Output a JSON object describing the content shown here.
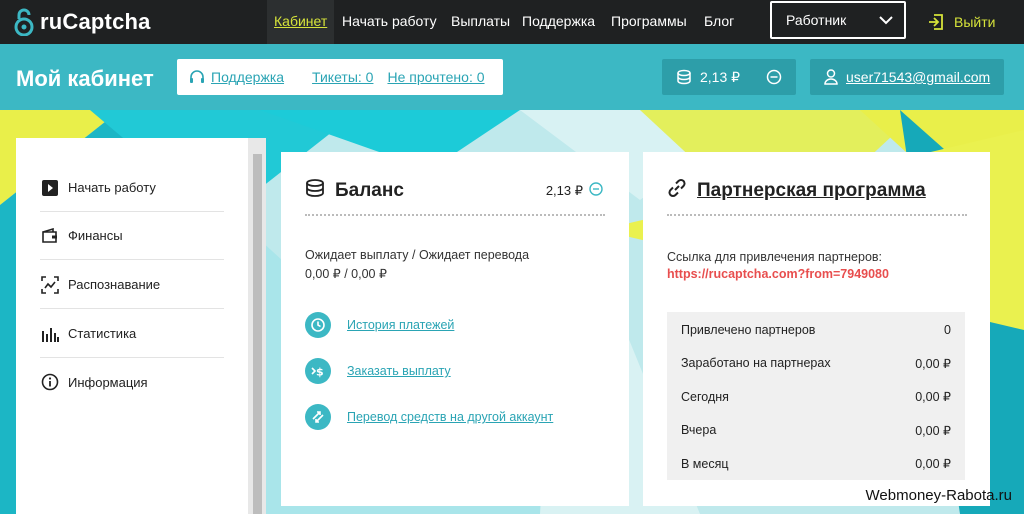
{
  "logo": {
    "text": "ruCaptcha"
  },
  "nav": {
    "items": [
      {
        "label": "Кабинет",
        "active": true
      },
      {
        "label": "Начать работу"
      },
      {
        "label": "Выплаты"
      },
      {
        "label": "Поддержка"
      },
      {
        "label": "Программы"
      },
      {
        "label": "Блог"
      }
    ],
    "role_select": "Работник",
    "logout": "Выйти"
  },
  "header": {
    "title": "Мой кабинет",
    "support_link": "Поддержка",
    "tickets_link": "Тикеты: 0",
    "unread_link": "Не прочтено: 0",
    "balance": "2,13 ₽",
    "user_email": "user71543@gmail.com"
  },
  "sidebar": {
    "items": [
      {
        "label": "Начать работу",
        "icon": "play-icon"
      },
      {
        "label": "Финансы",
        "icon": "wallet-icon"
      },
      {
        "label": "Распознавание",
        "icon": "recognition-icon"
      },
      {
        "label": "Статистика",
        "icon": "stats-icon"
      },
      {
        "label": "Информация",
        "icon": "info-icon"
      }
    ]
  },
  "balance_card": {
    "title": "Баланс",
    "amount": "2,13 ₽",
    "pending_label": "Ожидает выплату / Ожидает перевода",
    "pending_value": "0,00 ₽ / 0,00 ₽",
    "actions": [
      {
        "label": "История платежей",
        "icon": "history-icon"
      },
      {
        "label": "Заказать выплату",
        "icon": "payout-icon"
      },
      {
        "label": "Перевод средств на другой аккаунт",
        "icon": "transfer-icon"
      }
    ]
  },
  "partner_card": {
    "title": "Партнерская программа",
    "ref_label": "Ссылка для привлечения партнеров:",
    "ref_link": "https://rucaptcha.com?from=7949080",
    "stats": [
      {
        "label": "Привлечено партнеров",
        "value": "0"
      },
      {
        "label": "Заработано на партнерах",
        "value": "0,00 ₽"
      },
      {
        "label": "Сегодня",
        "value": "0,00 ₽"
      },
      {
        "label": "Вчера",
        "value": "0,00 ₽"
      },
      {
        "label": "В месяц",
        "value": "0,00 ₽"
      }
    ]
  },
  "watermark": "Webmoney-Rabota.ru",
  "colors": {
    "accent": "#3cb8c4",
    "nav_bg": "#1f2122",
    "active_link": "#d6e33a",
    "ref_link": "#e84e4e"
  }
}
